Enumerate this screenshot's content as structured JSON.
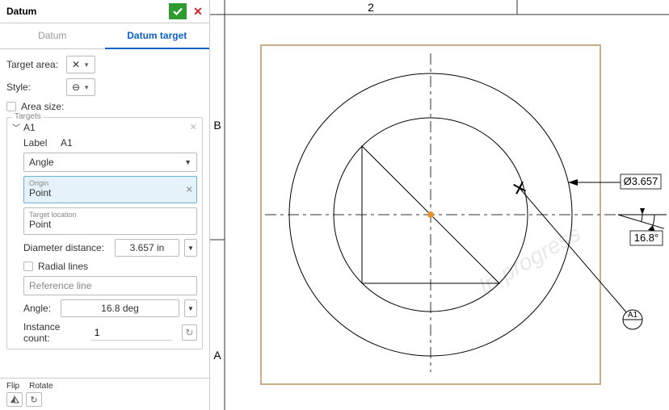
{
  "panel": {
    "title": "Datum",
    "tabs": {
      "datum": "Datum",
      "datum_target": "Datum target"
    },
    "target_area_label": "Target area:",
    "target_area_icon": "✕",
    "style_label": "Style:",
    "style_icon": "⊖",
    "area_size_label": "Area size:",
    "targets_group": "Targets",
    "target_name": "A1",
    "label_label": "Label",
    "label_value": "A1",
    "angle_dd": "Angle",
    "origin_label": "Origin",
    "origin_value": "Point",
    "target_loc_label": "Target location",
    "target_loc_value": "Point",
    "diameter_label": "Diameter distance:",
    "diameter_value": "3.657 in",
    "radial_lines_label": "Radial lines",
    "reference_line_ph": "Reference line",
    "angle_row_label": "Angle:",
    "angle_row_value": "16.8 deg",
    "instance_label": "Instance count:",
    "instance_value": "1",
    "flip_label": "Flip",
    "rotate_label": "Rotate"
  },
  "drawing": {
    "col_label": "2",
    "row_top": "B",
    "row_bottom": "A",
    "diameter_dim": "Ø3.657",
    "angle_dim": "16.8°",
    "datum_balloon": "A1",
    "watermark": "In progress"
  }
}
